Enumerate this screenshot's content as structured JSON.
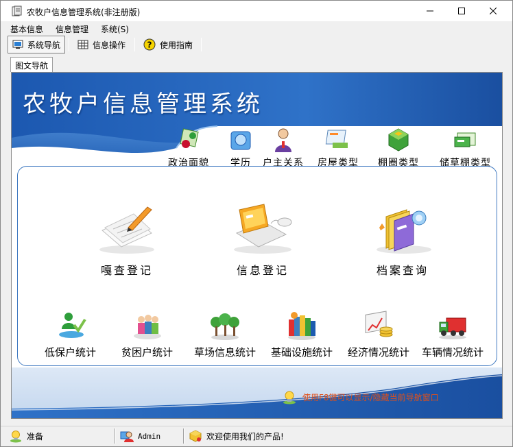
{
  "window": {
    "title": "农牧户信息管理系统(非注册版)",
    "min_icon": "minimize-icon",
    "max_icon": "maximize-icon",
    "close_icon": "close-icon"
  },
  "menu": {
    "items": [
      "基本信息",
      "信息管理",
      "系统(S)"
    ]
  },
  "toolbar": {
    "buttons": [
      {
        "label": "系统导航",
        "icon": "monitor-icon",
        "active": true
      },
      {
        "label": "信息操作",
        "icon": "grid-icon",
        "active": false
      },
      {
        "label": "使用指南",
        "icon": "help-icon",
        "active": false
      }
    ]
  },
  "tabs": {
    "active": "图文导航"
  },
  "banner": {
    "title": "农牧户信息管理系统"
  },
  "categories": [
    {
      "label": "政治面貌",
      "icon": "political-status-icon"
    },
    {
      "label": "学历",
      "icon": "education-icon"
    },
    {
      "label": "户主关系",
      "icon": "householder-relation-icon"
    },
    {
      "label": "房屋类型",
      "icon": "house-type-icon"
    },
    {
      "label": "棚圈类型",
      "icon": "shed-type-icon"
    },
    {
      "label": "储草棚类型",
      "icon": "hay-shed-type-icon"
    }
  ],
  "main_items": [
    {
      "label": "嘎查登记",
      "icon": "register-icon"
    },
    {
      "label": "信息登记",
      "icon": "laptop-icon"
    },
    {
      "label": "档案查询",
      "icon": "archive-icon"
    }
  ],
  "stat_items": [
    {
      "label": "低保户统计",
      "icon": "low-income-icon"
    },
    {
      "label": "贫困户统计",
      "icon": "poor-household-icon"
    },
    {
      "label": "草场信息统计",
      "icon": "grassland-icon"
    },
    {
      "label": "基础设施统计",
      "icon": "infrastructure-icon"
    },
    {
      "label": "经济情况统计",
      "icon": "economy-chart-icon"
    },
    {
      "label": "车辆情况统计",
      "icon": "truck-icon"
    }
  ],
  "hint": {
    "text": "使用F8键可以显示/隐藏当前导航窗口",
    "icon": "lightbulb-icon"
  },
  "status": {
    "state": "准备",
    "user": "Admin",
    "message": "欢迎使用我们的产品!"
  },
  "colors": {
    "banner_blue": "#1f5fb8",
    "box_border": "#3e78c0",
    "hint_orange": "#e0501a"
  }
}
